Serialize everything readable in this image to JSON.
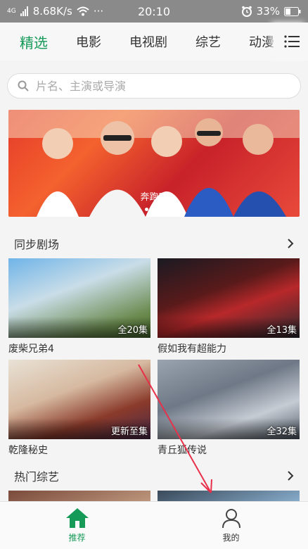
{
  "status": {
    "network": "4G",
    "speed": "8.68K/s",
    "more": "···",
    "time": "20:10",
    "battery": "33%"
  },
  "tabs": [
    {
      "label": "精选",
      "active": true
    },
    {
      "label": "电影"
    },
    {
      "label": "电视剧"
    },
    {
      "label": "综艺"
    },
    {
      "label": "动漫"
    }
  ],
  "search": {
    "placeholder": "片名、主演或导演"
  },
  "banner": {
    "caption": "奔跑吧"
  },
  "sections": {
    "sync": {
      "title": "同步剧场",
      "items": [
        {
          "name": "废柴兄弟4",
          "badge": "全20集"
        },
        {
          "name": "假如我有超能力",
          "badge": "全13集"
        },
        {
          "name": "乾隆秘史",
          "badge": "更新至集"
        },
        {
          "name": "青丘狐传说",
          "badge": "全32集"
        }
      ]
    },
    "variety": {
      "title": "热门综艺"
    }
  },
  "bottom_nav": {
    "recommend": "推荐",
    "mine": "我的"
  },
  "colors": {
    "accent": "#159a58",
    "status_bar": "#8a8a8a"
  }
}
